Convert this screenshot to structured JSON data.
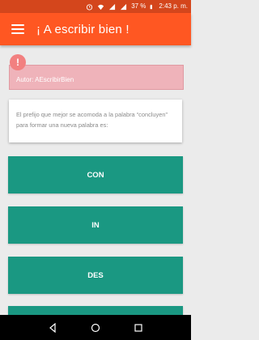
{
  "status_bar": {
    "battery_percent": "37 %",
    "time": "2:43 p. m.",
    "icons": [
      "alarm-icon",
      "wifi-icon",
      "signal-icon",
      "signal-icon",
      "battery-icon"
    ]
  },
  "app_bar": {
    "title": "¡ A escribir bien !",
    "menu_icon": "hamburger-menu-icon"
  },
  "author": {
    "label": "Autor: AEscribirBien",
    "icon": "warning-icon",
    "icon_glyph": "!"
  },
  "question": {
    "text": "El prefijo que mejor se acomoda a la palabra “concluyen” para formar una nueva palabra es:"
  },
  "answers": [
    {
      "label": "CON"
    },
    {
      "label": "IN"
    },
    {
      "label": "DES"
    },
    {
      "label": ""
    }
  ],
  "nav_bar": {
    "buttons": [
      "back-icon",
      "home-icon",
      "recents-icon"
    ]
  },
  "colors": {
    "status_bar": "#d4461c",
    "app_bar": "#ff5722",
    "answer_button": "#1a9882",
    "author_card": "#efb3ba",
    "background": "#ebebeb"
  }
}
